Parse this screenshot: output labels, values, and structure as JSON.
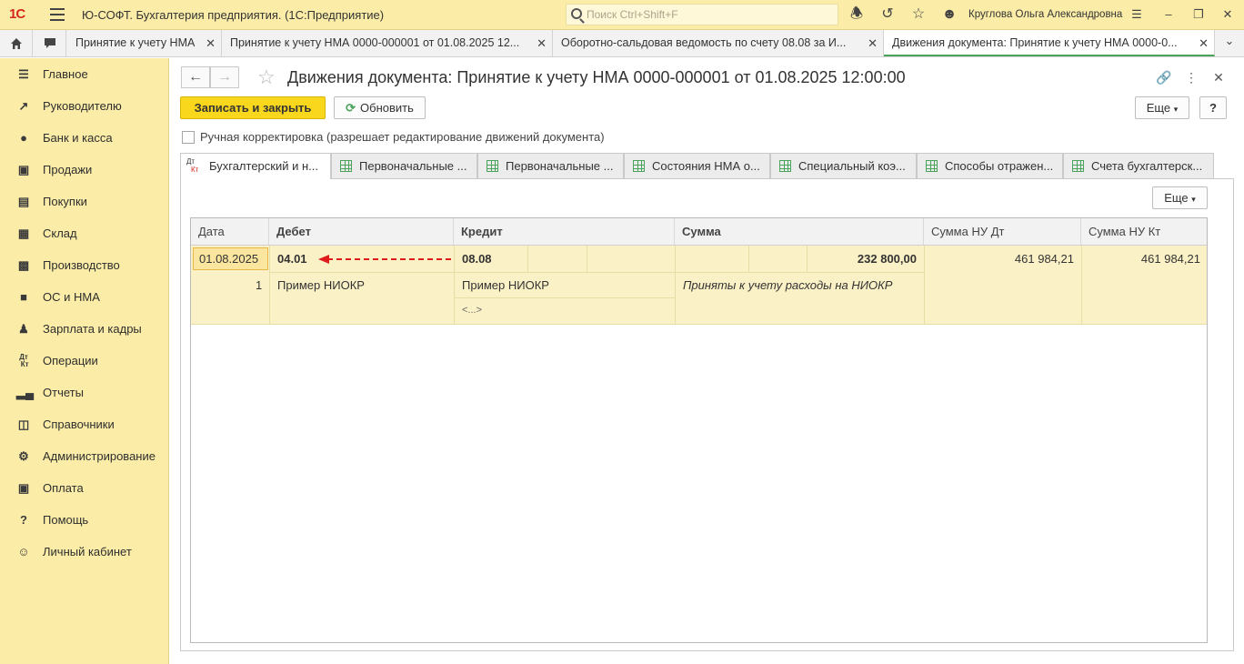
{
  "titlebar": {
    "logo": "1С",
    "app_title": "Ю-СОФТ. Бухгалтерия предприятия.  (1С:Предприятие)",
    "search_placeholder": "Поиск Ctrl+Shift+F",
    "user": "Круглова Ольга Александровна"
  },
  "tabs": [
    {
      "label": "Принятие к учету НМА"
    },
    {
      "label": "Принятие к учету НМА 0000-000001 от 01.08.2025 12..."
    },
    {
      "label": "Оборотно-сальдовая ведомость по счету 08.08 за И..."
    },
    {
      "label": "Движения документа: Принятие к учету НМА 0000-0...",
      "active": true
    }
  ],
  "sidebar": {
    "items": [
      {
        "label": "Главное",
        "icon": "menu-icon"
      },
      {
        "label": "Руководителю",
        "icon": "trend-icon"
      },
      {
        "label": "Банк и касса",
        "icon": "coin-icon"
      },
      {
        "label": "Продажи",
        "icon": "bag-icon"
      },
      {
        "label": "Покупки",
        "icon": "cart-icon"
      },
      {
        "label": "Склад",
        "icon": "warehouse-icon"
      },
      {
        "label": "Производство",
        "icon": "factory-icon"
      },
      {
        "label": "ОС и НМА",
        "icon": "truck-icon"
      },
      {
        "label": "Зарплата и кадры",
        "icon": "person-icon"
      },
      {
        "label": "Операции",
        "icon": "dtkt-icon"
      },
      {
        "label": "Отчеты",
        "icon": "bars-icon"
      },
      {
        "label": "Справочники",
        "icon": "book-icon"
      },
      {
        "label": "Администрирование",
        "icon": "gear-icon"
      },
      {
        "label": "Оплата",
        "icon": "wallet-icon"
      },
      {
        "label": "Помощь",
        "icon": "question-icon"
      },
      {
        "label": "Личный кабинет",
        "icon": "account-icon"
      }
    ]
  },
  "form": {
    "title": "Движения документа: Принятие к учету НМА 0000-000001 от 01.08.2025 12:00:00",
    "save_close": "Записать и закрыть",
    "refresh": "Обновить",
    "more": "Еще",
    "help": "?",
    "manual_label": "Ручная корректировка (разрешает редактирование движений документа)",
    "tabs": [
      "Бухгалтерский и н...",
      "Первоначальные ...",
      "Первоначальные ...",
      "Состояния НМА о...",
      "Специальный коэ...",
      "Способы отражен...",
      "Счета бухгалтерск..."
    ],
    "dt_label": "Дт",
    "kt_label": "Кт"
  },
  "table": {
    "more": "Еще",
    "columns": [
      "Дата",
      "Дебет",
      "Кредит",
      "Сумма",
      "Сумма НУ Дт",
      "Сумма НУ Кт"
    ],
    "row": {
      "date": "01.08.2025",
      "number": "1",
      "debit": "04.01",
      "debit_sub": "Пример НИОКР",
      "credit": "08.08",
      "credit_sub": "Пример НИОКР",
      "credit_sub2": "<...>",
      "sum": "232 800,00",
      "content": "Приняты к учету расходы на НИОКР",
      "nu_dt": "461 984,21",
      "nu_kt": "461 984,21"
    }
  },
  "colors": {
    "accent": "#f9d71c",
    "panel": "#fbeda8",
    "arrow": "#e01b1b"
  }
}
